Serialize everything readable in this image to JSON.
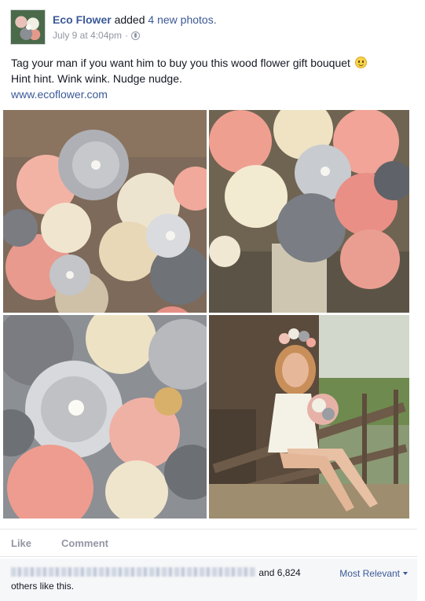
{
  "post": {
    "author": "Eco Flower",
    "action": "added",
    "action_count": "4 new photos.",
    "timestamp": "July 9 at 4:04pm",
    "separator": "·",
    "privacy_icon": "globe-icon",
    "text_line1": "Tag your man if you want him to buy you this wood flower gift bouquet",
    "text_line1_emoji": "smile-emoji",
    "text_line2": "Hint hint. Wink wink. Nudge nudge.",
    "link": "www.ecoflower.com",
    "photos": [
      {
        "id": "bouquet-top-view"
      },
      {
        "id": "bouquet-side-view"
      },
      {
        "id": "bouquet-closeup"
      },
      {
        "id": "woman-on-fence-with-bouquet"
      }
    ]
  },
  "actions": {
    "like": "Like",
    "comment": "Comment"
  },
  "likes": {
    "suffix_prefix": "and 6,824",
    "suffix_line2": "others like this.",
    "sort_label": "Most Relevant"
  },
  "colors": {
    "link_blue": "#3b5998",
    "meta_gray": "#9197a3",
    "text": "#141823",
    "likes_bg": "#f6f7f9"
  }
}
